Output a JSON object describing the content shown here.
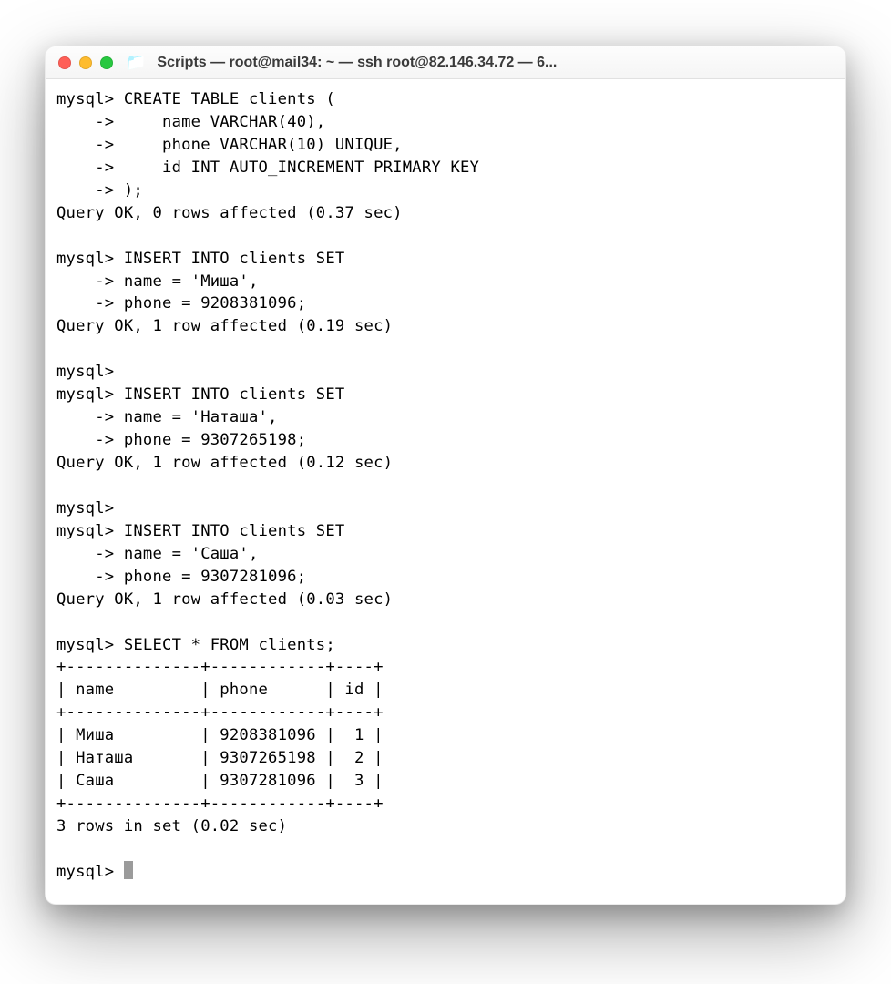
{
  "window": {
    "title": "Scripts — root@mail34: ~ — ssh root@82.146.34.72 — 6..."
  },
  "terminal": {
    "lines": [
      "mysql> CREATE TABLE clients (",
      "    ->     name VARCHAR(40),",
      "    ->     phone VARCHAR(10) UNIQUE,",
      "    ->     id INT AUTO_INCREMENT PRIMARY KEY",
      "    -> );",
      "Query OK, 0 rows affected (0.37 sec)",
      "",
      "mysql> INSERT INTO clients SET",
      "    -> name = 'Миша',",
      "    -> phone = 9208381096;",
      "Query OK, 1 row affected (0.19 sec)",
      "",
      "mysql>",
      "mysql> INSERT INTO clients SET",
      "    -> name = 'Наташа',",
      "    -> phone = 9307265198;",
      "Query OK, 1 row affected (0.12 sec)",
      "",
      "mysql>",
      "mysql> INSERT INTO clients SET",
      "    -> name = 'Саша',",
      "    -> phone = 9307281096;",
      "Query OK, 1 row affected (0.03 sec)",
      "",
      "mysql> SELECT * FROM clients;",
      "+--------------+------------+----+",
      "| name         | phone      | id |",
      "+--------------+------------+----+",
      "| Миша         | 9208381096 |  1 |",
      "| Наташа       | 9307265198 |  2 |",
      "| Саша         | 9307281096 |  3 |",
      "+--------------+------------+----+",
      "3 rows in set (0.02 sec)",
      "",
      "mysql> "
    ]
  }
}
